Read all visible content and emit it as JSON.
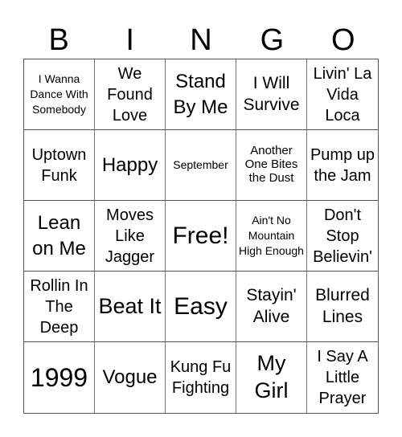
{
  "header": [
    "B",
    "I",
    "N",
    "G",
    "O"
  ],
  "cells": [
    {
      "text": "I Wanna Dance With Somebody",
      "size": "s14"
    },
    {
      "text": "We Found Love",
      "size": "s20"
    },
    {
      "text": "Stand By Me",
      "size": "s24"
    },
    {
      "text": "I Will Survive",
      "size": "s21"
    },
    {
      "text": "Livin' La Vida Loca",
      "size": "s20"
    },
    {
      "text": "Uptown Funk",
      "size": "s20"
    },
    {
      "text": "Happy",
      "size": "s24"
    },
    {
      "text": "September",
      "size": "s14"
    },
    {
      "text": "Another One Bites the Dust",
      "size": "s15"
    },
    {
      "text": "Pump up the Jam",
      "size": "s20"
    },
    {
      "text": "Lean on Me",
      "size": "s24"
    },
    {
      "text": "Moves Like Jagger",
      "size": "s20"
    },
    {
      "text": "Free!",
      "size": "s30"
    },
    {
      "text": "Ain't No Mountain High Enough",
      "size": "s14"
    },
    {
      "text": "Don't Stop Believin'",
      "size": "s20"
    },
    {
      "text": "Rollin In The Deep",
      "size": "s20"
    },
    {
      "text": "Beat It",
      "size": "s27"
    },
    {
      "text": "Easy",
      "size": "s30"
    },
    {
      "text": "Stayin' Alive",
      "size": "s21"
    },
    {
      "text": "Blurred Lines",
      "size": "s21"
    },
    {
      "text": "1999",
      "size": "s32"
    },
    {
      "text": "Vogue",
      "size": "s24"
    },
    {
      "text": "Kung Fu Fighting",
      "size": "s20"
    },
    {
      "text": "My Girl",
      "size": "s27"
    },
    {
      "text": "I Say A Little Prayer",
      "size": "s20"
    }
  ]
}
